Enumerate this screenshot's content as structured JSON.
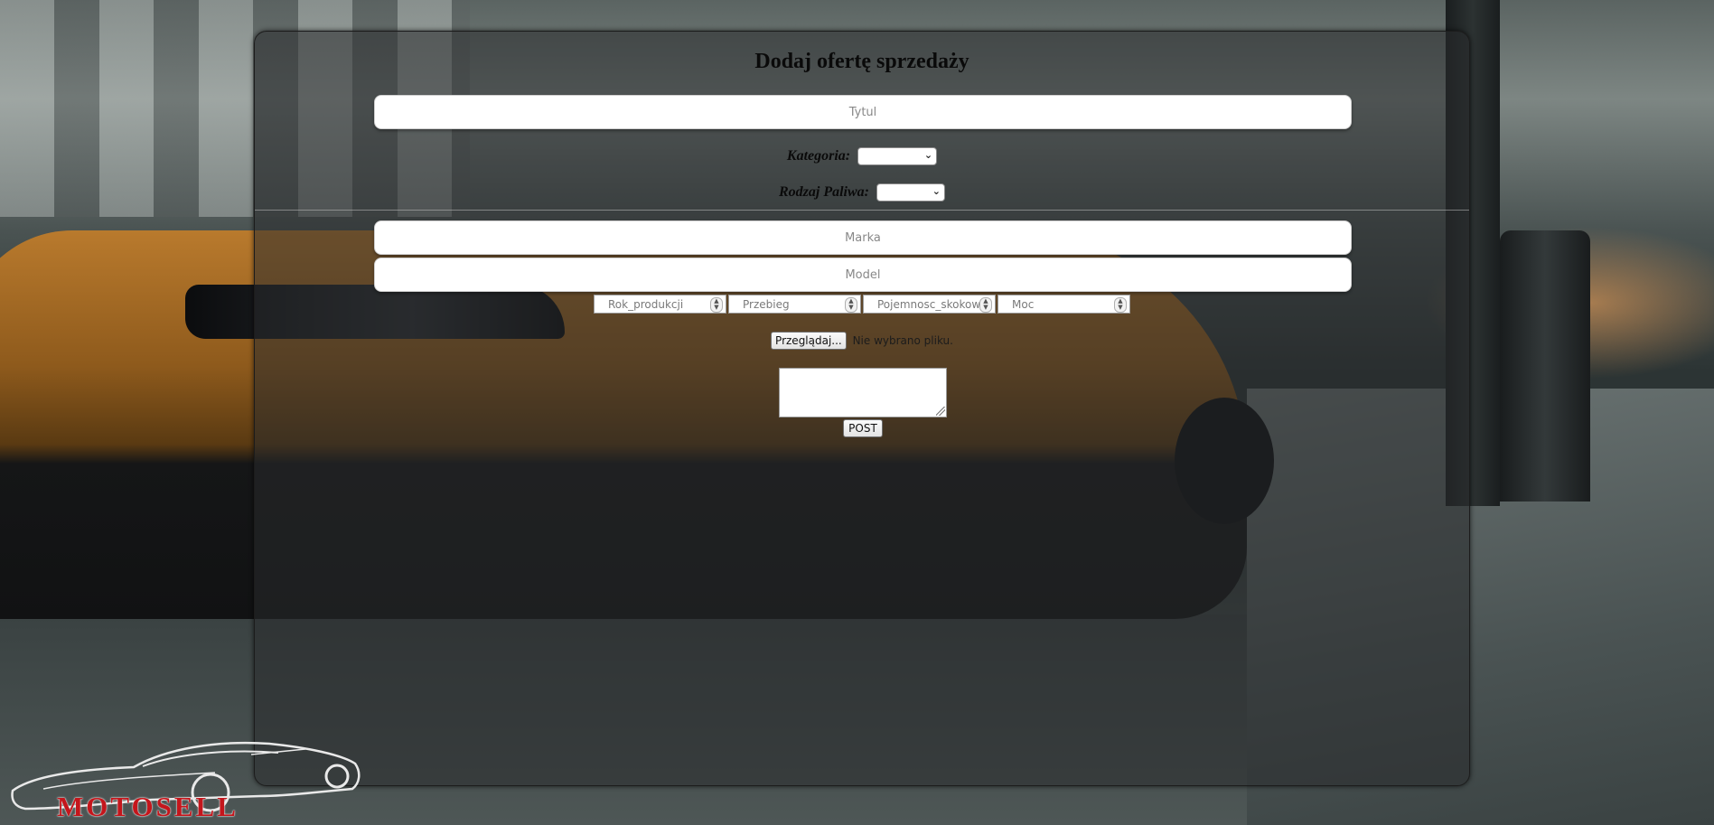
{
  "form": {
    "heading": "Dodaj ofertę sprzedaży",
    "title_placeholder": "Tytul",
    "category_label": "Kategoria:",
    "category_value": "",
    "fuel_label": "Rodzaj Paliwa:",
    "fuel_value": "",
    "brand_placeholder": "Marka",
    "model_placeholder": "Model",
    "year_placeholder": "Rok_produkcji",
    "mileage_placeholder": "Przebieg",
    "engine_placeholder": "Pojemnosc_skokowa",
    "power_placeholder": "Moc",
    "browse_button_label": "Przeglądaj...",
    "file_status": "Nie wybrano pliku.",
    "description_value": "",
    "submit_label": "POST"
  },
  "logo": {
    "text": "MOTOSELL",
    "text_color": "#c4161c"
  },
  "icons": {
    "dropdown": "chevron-down-icon",
    "spinner": "number-spinner-icon",
    "resize": "resize-grip-icon",
    "logo": "sports-car-outline-icon"
  },
  "colors": {
    "panel_background": "rgba(40,42,44,0.55)",
    "input_background": "#ffffff",
    "heading_color": "#0a0a0a"
  }
}
